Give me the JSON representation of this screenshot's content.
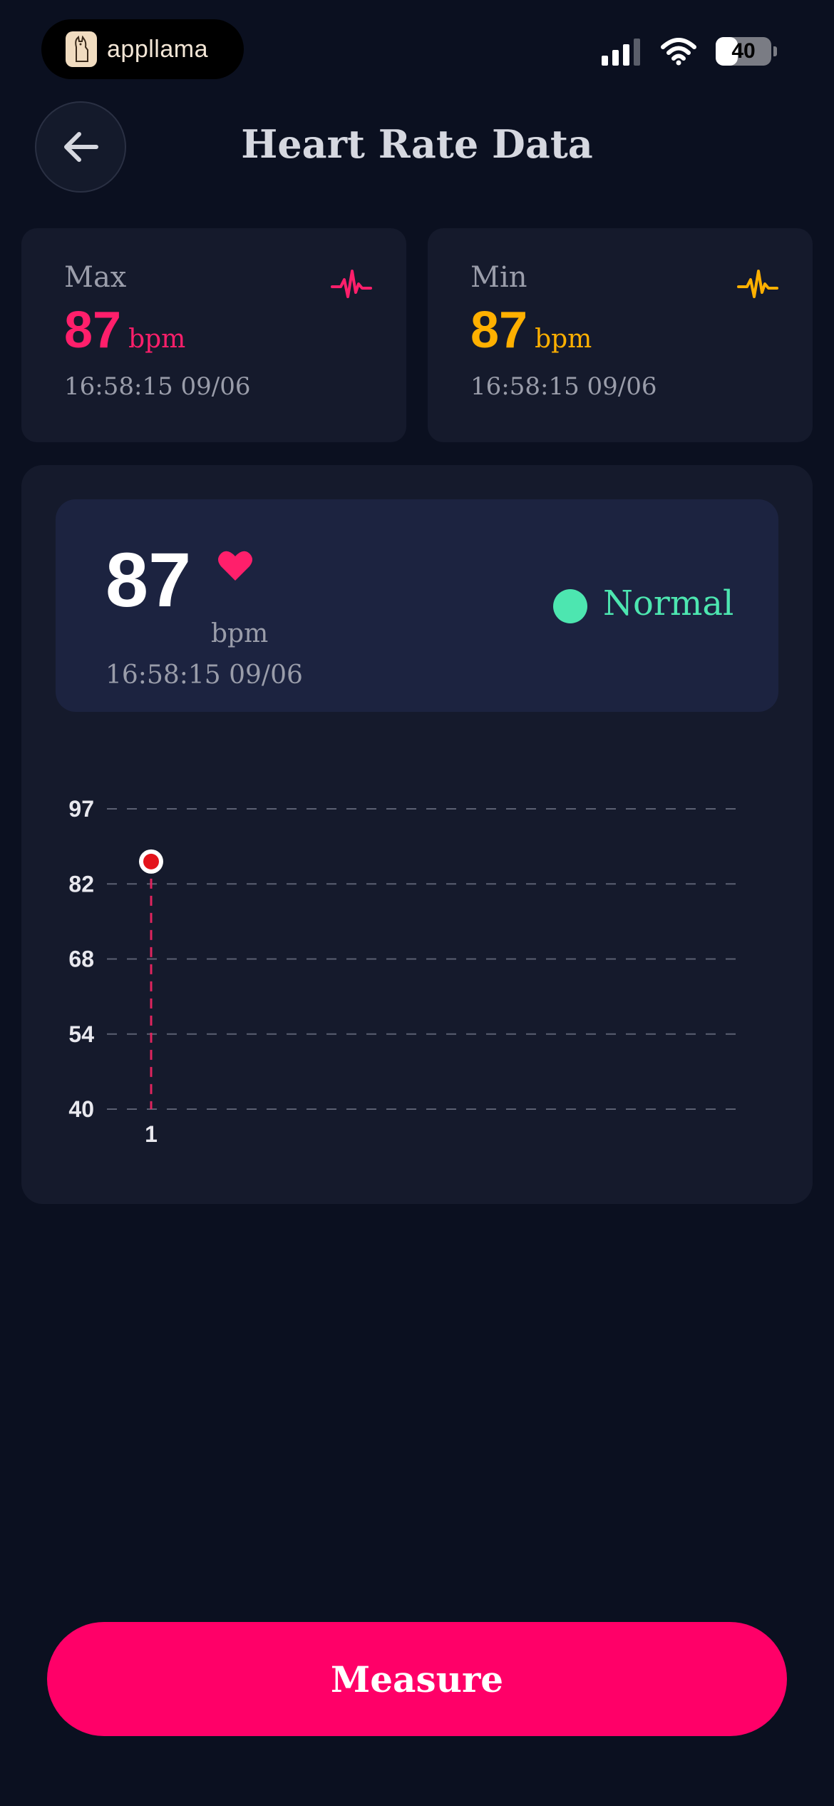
{
  "status_bar": {
    "app_name": "appllama",
    "battery": "40",
    "battery_level": 0.4
  },
  "header": {
    "title": "Heart Rate Data",
    "back_icon": "arrow-left-icon"
  },
  "stats": {
    "max": {
      "label": "Max",
      "value": "87",
      "unit": "bpm",
      "time": "16:58:15 09/06",
      "color": "#ff1f6b",
      "icon": "pulse-icon"
    },
    "min": {
      "label": "Min",
      "value": "87",
      "unit": "bpm",
      "time": "16:58:15 09/06",
      "color": "#ffb000",
      "icon": "pulse-icon"
    }
  },
  "current": {
    "value": "87",
    "unit": "bpm",
    "time": "16:58:15 09/06",
    "status": "Normal",
    "status_color": "#4de6b0"
  },
  "chart_data": {
    "type": "line",
    "x": [
      1
    ],
    "x_ticks": [
      "1"
    ],
    "values": [
      87
    ],
    "y_ticks": [
      97,
      82,
      68,
      54,
      40
    ],
    "ylim": [
      40,
      97
    ],
    "grid": true,
    "colors": {
      "point": "#e4141c",
      "drop_line": "#e0245e",
      "grid": "#5b6072"
    }
  },
  "action": {
    "measure_label": "Measure",
    "color": "#ff0068"
  }
}
